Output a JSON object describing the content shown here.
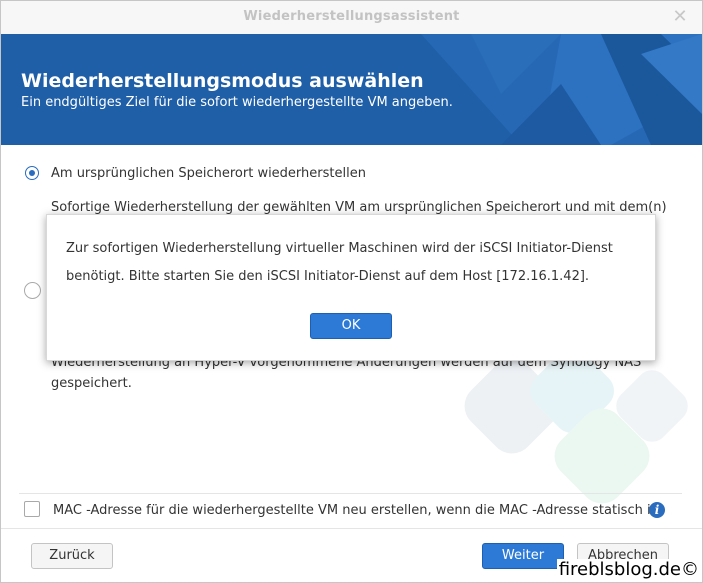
{
  "window": {
    "title": "Wiederherstellungsassistent",
    "close_glyph": "✕"
  },
  "banner": {
    "heading": "Wiederherstellungsmodus auswählen",
    "subtitle": "Ein endgültiges Ziel für die sofort wiederhergestellte VM angeben.",
    "color": "#1f5fa8"
  },
  "options": [
    {
      "label": "Am ursprünglichen Speicherort wiederherstellen",
      "selected": true,
      "description": "Sofortige Wiederherstellung der gewählten VM am ursprünglichen Speicherort und mit dem(n)"
    },
    {
      "selected": false,
      "description_lines": [
        "Wiederherstellung an Hyper-V vorgenommene Änderungen werden auf dem Synology NAS",
        "gespeichert."
      ]
    }
  ],
  "mac_option": {
    "label": "MAC -Adresse für die wiederhergestellte VM neu erstellen, wenn die MAC -Adresse statisch ist",
    "checked": false,
    "info_glyph": "i"
  },
  "footer": {
    "back_label": "Zurück",
    "next_label": "Weiter",
    "cancel_label": "Abbrechen"
  },
  "dialog": {
    "message_line1": "Zur sofortigen Wiederherstellung virtueller Maschinen wird der iSCSI Initiator-Dienst",
    "message_line2": "benötigt. Bitte starten Sie den iSCSI Initiator-Dienst auf dem Host [172.16.1.42].",
    "ok_label": "OK"
  },
  "credit": "fireblsblog.de©",
  "colors": {
    "accent": "#2d7ad6",
    "radio": "#2a6cbe"
  }
}
